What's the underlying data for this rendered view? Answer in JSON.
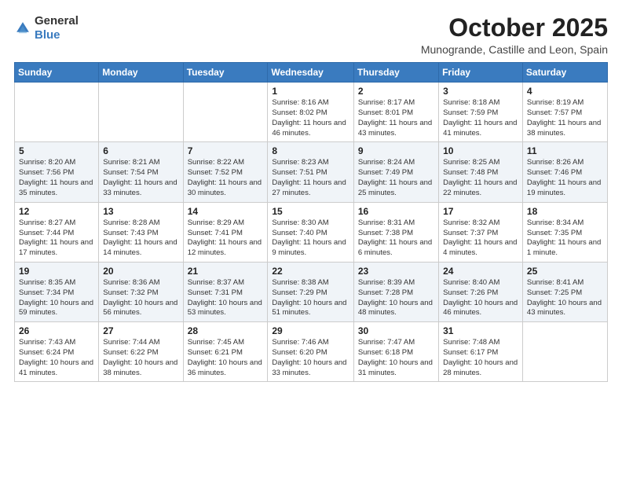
{
  "logo": {
    "general": "General",
    "blue": "Blue"
  },
  "header": {
    "month": "October 2025",
    "location": "Munogrande, Castille and Leon, Spain"
  },
  "weekdays": [
    "Sunday",
    "Monday",
    "Tuesday",
    "Wednesday",
    "Thursday",
    "Friday",
    "Saturday"
  ],
  "weeks": [
    {
      "alt": false,
      "days": [
        {
          "num": "",
          "info": ""
        },
        {
          "num": "",
          "info": ""
        },
        {
          "num": "",
          "info": ""
        },
        {
          "num": "1",
          "info": "Sunrise: 8:16 AM\nSunset: 8:02 PM\nDaylight: 11 hours\nand 46 minutes."
        },
        {
          "num": "2",
          "info": "Sunrise: 8:17 AM\nSunset: 8:01 PM\nDaylight: 11 hours\nand 43 minutes."
        },
        {
          "num": "3",
          "info": "Sunrise: 8:18 AM\nSunset: 7:59 PM\nDaylight: 11 hours\nand 41 minutes."
        },
        {
          "num": "4",
          "info": "Sunrise: 8:19 AM\nSunset: 7:57 PM\nDaylight: 11 hours\nand 38 minutes."
        }
      ]
    },
    {
      "alt": true,
      "days": [
        {
          "num": "5",
          "info": "Sunrise: 8:20 AM\nSunset: 7:56 PM\nDaylight: 11 hours\nand 35 minutes."
        },
        {
          "num": "6",
          "info": "Sunrise: 8:21 AM\nSunset: 7:54 PM\nDaylight: 11 hours\nand 33 minutes."
        },
        {
          "num": "7",
          "info": "Sunrise: 8:22 AM\nSunset: 7:52 PM\nDaylight: 11 hours\nand 30 minutes."
        },
        {
          "num": "8",
          "info": "Sunrise: 8:23 AM\nSunset: 7:51 PM\nDaylight: 11 hours\nand 27 minutes."
        },
        {
          "num": "9",
          "info": "Sunrise: 8:24 AM\nSunset: 7:49 PM\nDaylight: 11 hours\nand 25 minutes."
        },
        {
          "num": "10",
          "info": "Sunrise: 8:25 AM\nSunset: 7:48 PM\nDaylight: 11 hours\nand 22 minutes."
        },
        {
          "num": "11",
          "info": "Sunrise: 8:26 AM\nSunset: 7:46 PM\nDaylight: 11 hours\nand 19 minutes."
        }
      ]
    },
    {
      "alt": false,
      "days": [
        {
          "num": "12",
          "info": "Sunrise: 8:27 AM\nSunset: 7:44 PM\nDaylight: 11 hours\nand 17 minutes."
        },
        {
          "num": "13",
          "info": "Sunrise: 8:28 AM\nSunset: 7:43 PM\nDaylight: 11 hours\nand 14 minutes."
        },
        {
          "num": "14",
          "info": "Sunrise: 8:29 AM\nSunset: 7:41 PM\nDaylight: 11 hours\nand 12 minutes."
        },
        {
          "num": "15",
          "info": "Sunrise: 8:30 AM\nSunset: 7:40 PM\nDaylight: 11 hours\nand 9 minutes."
        },
        {
          "num": "16",
          "info": "Sunrise: 8:31 AM\nSunset: 7:38 PM\nDaylight: 11 hours\nand 6 minutes."
        },
        {
          "num": "17",
          "info": "Sunrise: 8:32 AM\nSunset: 7:37 PM\nDaylight: 11 hours\nand 4 minutes."
        },
        {
          "num": "18",
          "info": "Sunrise: 8:34 AM\nSunset: 7:35 PM\nDaylight: 11 hours\nand 1 minute."
        }
      ]
    },
    {
      "alt": true,
      "days": [
        {
          "num": "19",
          "info": "Sunrise: 8:35 AM\nSunset: 7:34 PM\nDaylight: 10 hours\nand 59 minutes."
        },
        {
          "num": "20",
          "info": "Sunrise: 8:36 AM\nSunset: 7:32 PM\nDaylight: 10 hours\nand 56 minutes."
        },
        {
          "num": "21",
          "info": "Sunrise: 8:37 AM\nSunset: 7:31 PM\nDaylight: 10 hours\nand 53 minutes."
        },
        {
          "num": "22",
          "info": "Sunrise: 8:38 AM\nSunset: 7:29 PM\nDaylight: 10 hours\nand 51 minutes."
        },
        {
          "num": "23",
          "info": "Sunrise: 8:39 AM\nSunset: 7:28 PM\nDaylight: 10 hours\nand 48 minutes."
        },
        {
          "num": "24",
          "info": "Sunrise: 8:40 AM\nSunset: 7:26 PM\nDaylight: 10 hours\nand 46 minutes."
        },
        {
          "num": "25",
          "info": "Sunrise: 8:41 AM\nSunset: 7:25 PM\nDaylight: 10 hours\nand 43 minutes."
        }
      ]
    },
    {
      "alt": false,
      "days": [
        {
          "num": "26",
          "info": "Sunrise: 7:43 AM\nSunset: 6:24 PM\nDaylight: 10 hours\nand 41 minutes."
        },
        {
          "num": "27",
          "info": "Sunrise: 7:44 AM\nSunset: 6:22 PM\nDaylight: 10 hours\nand 38 minutes."
        },
        {
          "num": "28",
          "info": "Sunrise: 7:45 AM\nSunset: 6:21 PM\nDaylight: 10 hours\nand 36 minutes."
        },
        {
          "num": "29",
          "info": "Sunrise: 7:46 AM\nSunset: 6:20 PM\nDaylight: 10 hours\nand 33 minutes."
        },
        {
          "num": "30",
          "info": "Sunrise: 7:47 AM\nSunset: 6:18 PM\nDaylight: 10 hours\nand 31 minutes."
        },
        {
          "num": "31",
          "info": "Sunrise: 7:48 AM\nSunset: 6:17 PM\nDaylight: 10 hours\nand 28 minutes."
        },
        {
          "num": "",
          "info": ""
        }
      ]
    }
  ]
}
